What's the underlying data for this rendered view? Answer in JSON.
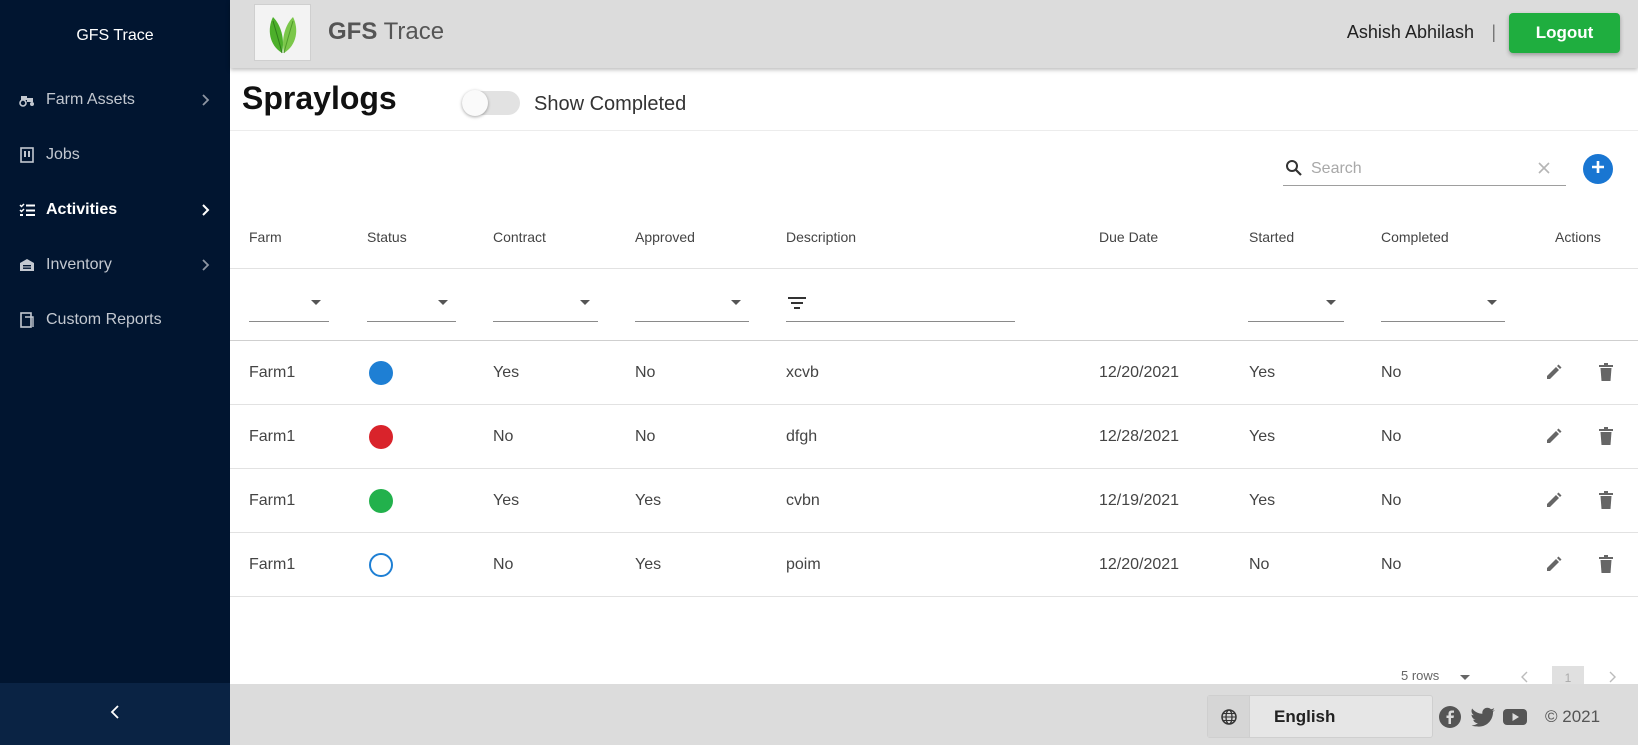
{
  "sidebar": {
    "brand": "GFS Trace",
    "items": [
      {
        "label": "Farm Assets",
        "icon": "tractor-icon",
        "has_chevron": true,
        "active": false
      },
      {
        "label": "Jobs",
        "icon": "jobs-icon",
        "has_chevron": false,
        "active": false
      },
      {
        "label": "Activities",
        "icon": "list-checks-icon",
        "has_chevron": true,
        "active": true
      },
      {
        "label": "Inventory",
        "icon": "warehouse-icon",
        "has_chevron": true,
        "active": false
      },
      {
        "label": "Custom Reports",
        "icon": "report-icon",
        "has_chevron": false,
        "active": false
      }
    ],
    "collapse_icon": "chevron-left-icon"
  },
  "header": {
    "app_title_bold": "GFS",
    "app_title_rest": " Trace",
    "user_name": "Ashish Abhilash",
    "separator": "|",
    "logout_label": "Logout"
  },
  "page": {
    "title": "Spraylogs",
    "show_completed_label": "Show Completed",
    "show_completed": false
  },
  "search": {
    "placeholder": "Search",
    "value": ""
  },
  "table": {
    "columns": [
      "Farm",
      "Status",
      "Contract",
      "Approved",
      "Description",
      "Due Date",
      "Started",
      "Completed",
      "Actions"
    ],
    "rows": [
      {
        "farm": "Farm1",
        "status_color": "#1e7fd4",
        "status_filled": true,
        "contract": "Yes",
        "approved": "No",
        "description": "xcvb",
        "due_date": "12/20/2021",
        "started": "Yes",
        "completed": "No"
      },
      {
        "farm": "Farm1",
        "status_color": "#d9232b",
        "status_filled": true,
        "contract": "No",
        "approved": "No",
        "description": "dfgh",
        "due_date": "12/28/2021",
        "started": "Yes",
        "completed": "No"
      },
      {
        "farm": "Farm1",
        "status_color": "#22b14c",
        "status_filled": true,
        "contract": "Yes",
        "approved": "Yes",
        "description": "cvbn",
        "due_date": "12/19/2021",
        "started": "Yes",
        "completed": "No"
      },
      {
        "farm": "Farm1",
        "status_color": "#1e7fd4",
        "status_filled": false,
        "contract": "No",
        "approved": "Yes",
        "description": "poim",
        "due_date": "12/20/2021",
        "started": "No",
        "completed": "No"
      }
    ]
  },
  "pager": {
    "rows_label": "5 rows",
    "page": "1"
  },
  "footer": {
    "language": "English",
    "copyright": "© 2021",
    "social": [
      "facebook-icon",
      "twitter-icon",
      "youtube-icon"
    ]
  },
  "colors": {
    "sidebar_bg": "#011530",
    "accent_green": "#1fae3f",
    "accent_blue": "#1976d2"
  }
}
